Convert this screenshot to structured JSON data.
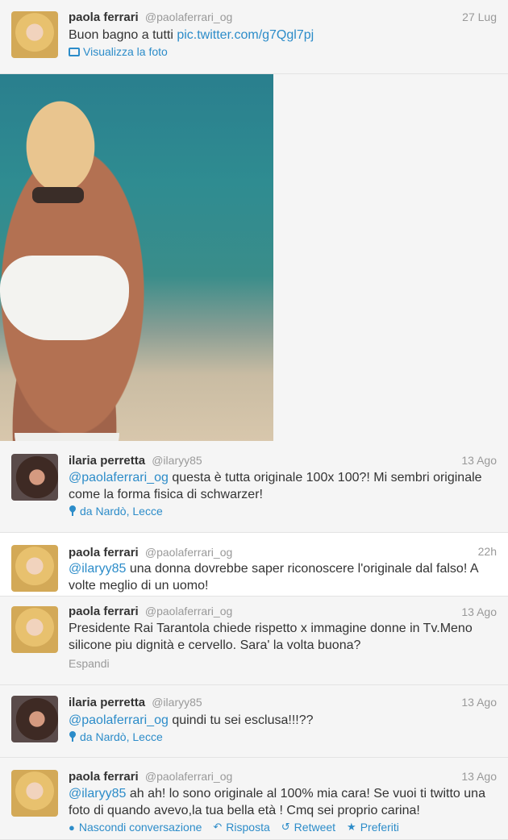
{
  "tweets": [
    {
      "name": "paola ferrari",
      "handle": "@paolaferrari_og",
      "time": "27 Lug",
      "text": "Buon bagno a tutti ",
      "link": "pic.twitter.com/g7Qgl7pj",
      "meta": "Visualizza la foto"
    },
    {
      "name": "ilaria perretta",
      "handle": "@ilaryy85",
      "time": "13 Ago",
      "mention": "@paolaferrari_og",
      "text": " questa è tutta originale 100x 100?! Mi sembri originale come la forma fisica di schwarzer!",
      "meta": "da Nardò, Lecce"
    },
    {
      "name": "paola ferrari",
      "handle": "@paolaferrari_og",
      "time": "22h",
      "mention": "@ilaryy85",
      "text": " una donna dovrebbe saper riconoscere l'originale dal falso! A volte meglio di un uomo!"
    },
    {
      "name": "paola ferrari",
      "handle": "@paolaferrari_og",
      "time": "13 Ago",
      "text": "Presidente Rai Tarantola chiede rispetto x immagine donne in Tv.Meno silicone piu dignità e cervello. Sara' la volta buona?",
      "meta": "Espandi"
    },
    {
      "name": "ilaria perretta",
      "handle": "@ilaryy85",
      "time": "13 Ago",
      "mention": "@paolaferrari_og",
      "text": " quindi tu sei esclusa!!!??",
      "meta": "da Nardò, Lecce"
    },
    {
      "name": "paola ferrari",
      "handle": "@paolaferrari_og",
      "time": "13 Ago",
      "mention": "@ilaryy85",
      "text": " ah ah! lo sono originale al 100% mia cara! Se vuoi ti twitto una foto di quando avevo,la tua bella età ! Cmq sei proprio carina!",
      "actions": {
        "hide": "Nascondi conversazione",
        "reply": "Risposta",
        "retweet": "Retweet",
        "favorite": "Preferiti"
      }
    }
  ],
  "colors": {
    "link": "#2c8cc9",
    "muted": "#999999",
    "text": "#333333"
  }
}
